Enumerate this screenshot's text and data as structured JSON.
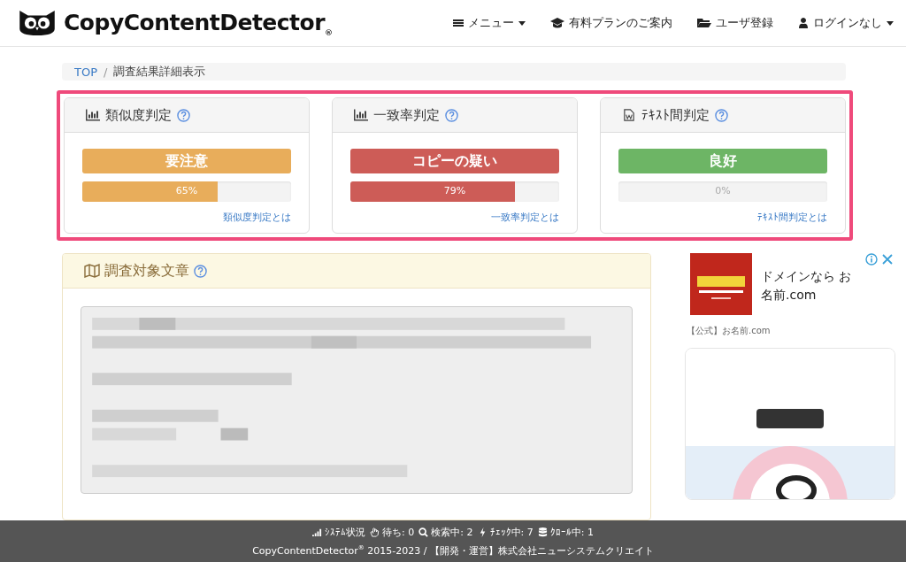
{
  "header": {
    "logo": "CopyContentDetector$_{®}$",
    "nav": [
      {
        "kind": "menu",
        "label": "メニュー",
        "caret": true
      },
      {
        "kind": "cap",
        "label": "有料プランのご案内",
        "caret": false
      },
      {
        "kind": "folder",
        "label": "ユーザ登録",
        "caret": false
      },
      {
        "kind": "user",
        "label": "ログインなし",
        "caret": true
      }
    ]
  },
  "breadcrumb": {
    "separator": "/",
    "items": [
      {
        "label": "TOP",
        "link": true
      },
      {
        "label": "調査結果詳細表示",
        "link": false
      }
    ]
  },
  "judgments": [
    {
      "kind": "chart",
      "title": "類似度判定",
      "verdict": "要注意",
      "color": "#e8ad5b",
      "level": 0.65,
      "reading": "65%",
      "link": "類似度判定とは"
    },
    {
      "kind": "chart",
      "title": "一致率判定",
      "verdict": "コピーの疑い",
      "color": "#cd5c57",
      "level": 0.79,
      "reading": "79%",
      "link": "一致率判定とは"
    },
    {
      "kind": "doc",
      "title": "ﾃｷｽﾄ間判定",
      "verdict": "良好",
      "color": "#6db565",
      "level": 0,
      "reading": "0%",
      "link": "ﾃｷｽﾄ間判定とは"
    }
  ],
  "target": {
    "title": "調査対象文章"
  },
  "ad": {
    "headline": "ドメインなら お名前.com",
    "source": "【公式】お名前.com"
  },
  "footer": {
    "status": [
      {
        "kind": "signal",
        "text": "ｼｽﾃﾑ状況"
      },
      {
        "kind": "hand",
        "text": "待ち: 0"
      },
      {
        "kind": "search",
        "text": "検索中: 2"
      },
      {
        "kind": "bolt",
        "text": "ﾁｪｯｸ中: 7"
      },
      {
        "kind": "db",
        "text": "ｸﾛｰﾙ中: 1"
      }
    ],
    "copyright": "CopyContentDetector$^{®}$ 2015-2023 / 【開発・運営】株式会社ニューシステムクリエイト"
  }
}
